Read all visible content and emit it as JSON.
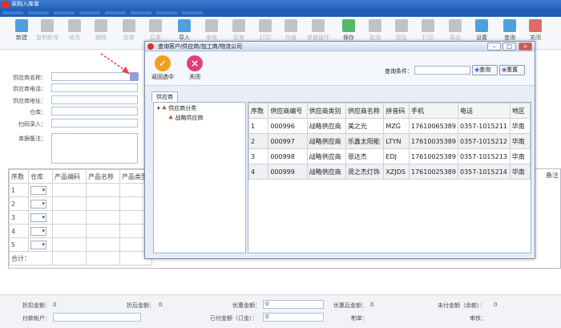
{
  "window": {
    "title": "采购入库单"
  },
  "toolbar": {
    "left_buttons": [
      {
        "label": "新建",
        "color": "#2a8ad6",
        "dim": false
      },
      {
        "label": "复制新增",
        "color": "#b0b6bf",
        "dim": true
      },
      {
        "label": "修改",
        "color": "#b0b6bf",
        "dim": true
      },
      {
        "label": "删除",
        "color": "#b0b6bf",
        "dim": true
      },
      {
        "label": "前单",
        "color": "#b0b6bf",
        "dim": true
      },
      {
        "label": "后单",
        "color": "#b0b6bf",
        "dim": true
      },
      {
        "label": "导入",
        "color": "#2a8ad6",
        "dim": false
      },
      {
        "label": "审核",
        "color": "#b0b6bf",
        "dim": true
      },
      {
        "label": "反审",
        "color": "#b0b6bf",
        "dim": true
      },
      {
        "label": "打印",
        "color": "#b0b6bf",
        "dim": true
      },
      {
        "label": "作废",
        "color": "#b0b6bf",
        "dim": true
      },
      {
        "label": "单据操作",
        "color": "#b0b6bf",
        "dim": true
      },
      {
        "label": "保存",
        "color": "#2fa84f",
        "dim": false
      },
      {
        "label": "取消",
        "color": "#b0b6bf",
        "dim": true
      },
      {
        "label": "预览",
        "color": "#b0b6bf",
        "dim": true
      },
      {
        "label": "打印",
        "color": "#b0b6bf",
        "dim": true
      },
      {
        "label": "导出",
        "color": "#b0b6bf",
        "dim": true
      },
      {
        "label": "设置",
        "color": "#2a8ad6",
        "dim": false
      },
      {
        "label": "查询",
        "color": "#2a8ad6",
        "dim": false
      },
      {
        "label": "关闭",
        "color": "#d84a4a",
        "dim": false
      }
    ]
  },
  "form": {
    "supplier_name_label": "供应商名称：",
    "supplier_phone_label": "供应商电话：",
    "supplier_address_label": "供应商地址：",
    "warehouse_label": "仓库：",
    "scan_label": "扫码录入：",
    "remark_label": "单据备注："
  },
  "grid": {
    "headers": [
      "序数",
      "仓库",
      "产品编码",
      "产品名称",
      "产品类型"
    ],
    "rows": [
      "1",
      "2",
      "3",
      "4",
      "5"
    ],
    "total_label": "合计：",
    "right_header": "备注"
  },
  "footer": {
    "discount_amount_label": "折扣金额：",
    "discount_amount_value": "0",
    "after_discount_label": "折后金额：",
    "after_discount_value": "0",
    "promo_amount_label": "优惠金额：",
    "promo_amount_value": "0",
    "after_promo_label": "优惠后金额：",
    "after_promo_value": "0",
    "unpaid_label": "未付金额（余款）：",
    "unpaid_value": "0",
    "payment_account_label": "付款帐户：",
    "paid_amount_label": "已付金额（订金）：",
    "paid_amount_value": "0",
    "maker_label": "制单：",
    "reviewer_label": "审核："
  },
  "modal": {
    "title": "查询客户/供应商/加工商/物流公司",
    "select_label": "返回选中",
    "close_label": "关闭",
    "query_label": "查询条件：",
    "query_value": "",
    "search_button": "查询",
    "reset_button": "重置",
    "tab": "供应商",
    "tree_root": "供应商分类",
    "tree_child": "战略供应商",
    "columns": [
      "序数",
      "供应商编号",
      "供应商类别",
      "供应商名称",
      "拼音码",
      "手机",
      "电话",
      "地区"
    ],
    "rows": [
      [
        "1",
        "000996",
        "战略供应商",
        "美之光",
        "MZG",
        "17610065389",
        "0357-1015211",
        "华南"
      ],
      [
        "2",
        "000997",
        "战略供应商",
        "乐鑫太阳能",
        "LTYN",
        "17610035389",
        "0357-1015212",
        "华南"
      ],
      [
        "3",
        "000998",
        "战略供应商",
        "恩达杰",
        "EDJ",
        "17610025389",
        "0357-1015213",
        "华南"
      ],
      [
        "4",
        "000999",
        "战略供应商",
        "贤之杰灯饰",
        "XZJDS",
        "17610025389",
        "0357-1015214",
        "华南"
      ]
    ]
  }
}
